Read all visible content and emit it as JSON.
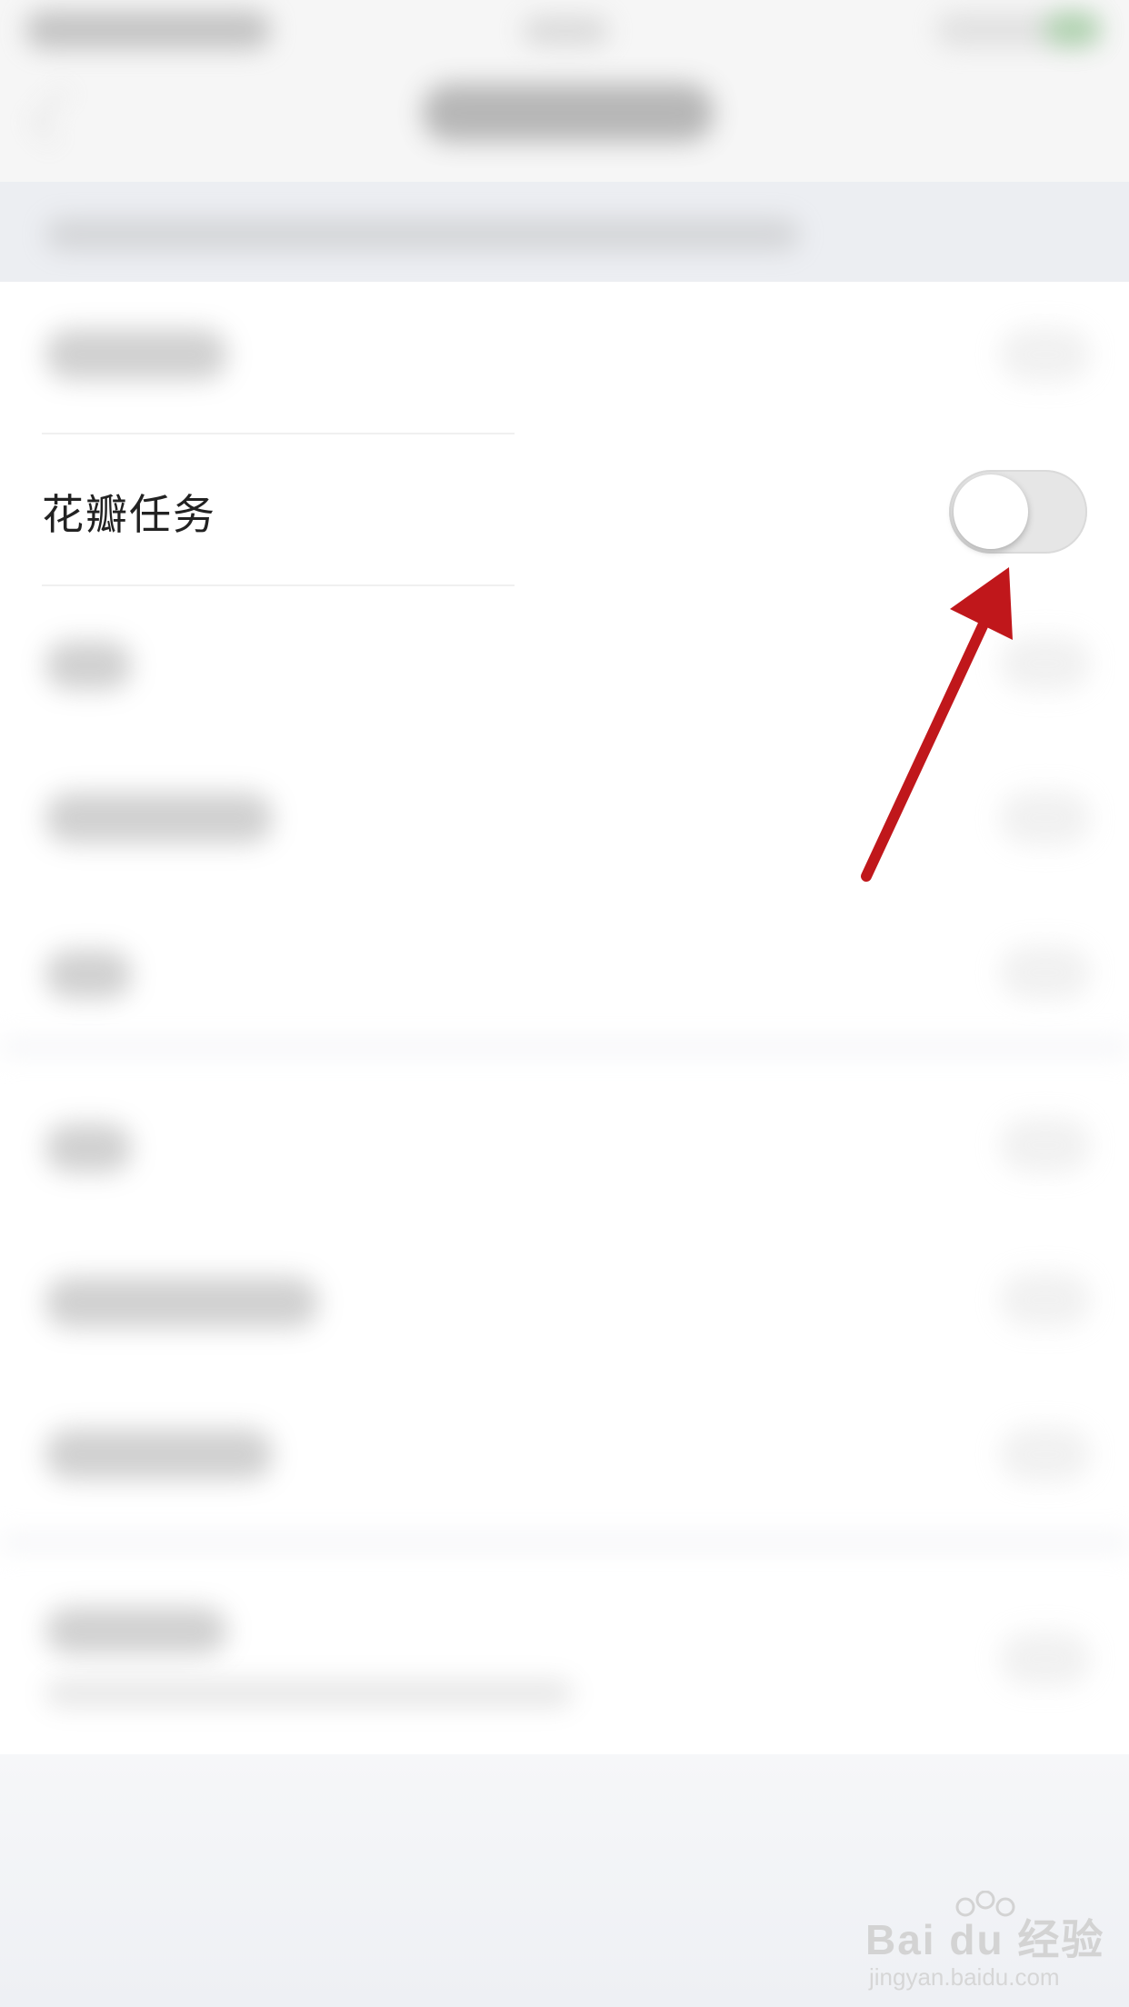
{
  "settings": {
    "petal_task": {
      "label": "花瓣任务",
      "enabled": false
    }
  },
  "watermark": {
    "brand": "Bai du 经验",
    "url": "jingyan.baidu.com"
  },
  "colors": {
    "arrow": "#c0171b",
    "toggle_off": "#e6e6e6"
  }
}
